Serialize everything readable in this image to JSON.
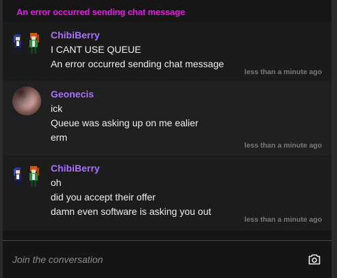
{
  "error_banner": "An error occurred sending chat message",
  "messages": [
    {
      "author": "ChibiBerry",
      "lines": [
        "I CANT USE QUEUE",
        "An error occurred sending chat message"
      ],
      "time": "less than a minute ago",
      "avatar": "pixel-art-characters"
    },
    {
      "author": "Geonecis",
      "lines": [
        "ick",
        "Queue was asking up on me ealier",
        "erm"
      ],
      "time": "less than a minute ago",
      "avatar": "photo"
    },
    {
      "author": "ChibiBerry",
      "lines": [
        "oh",
        "did you accept their offer",
        "damn even software is asking you out"
      ],
      "time": "less than a minute ago",
      "avatar": "pixel-art-characters"
    }
  ],
  "composer": {
    "placeholder": "Join the conversation",
    "camera_icon": "camera-icon"
  },
  "colors": {
    "error": "#e21be0",
    "username": "#a970ff",
    "timestamp": "#7a7a7a",
    "text": "#efeff1"
  }
}
